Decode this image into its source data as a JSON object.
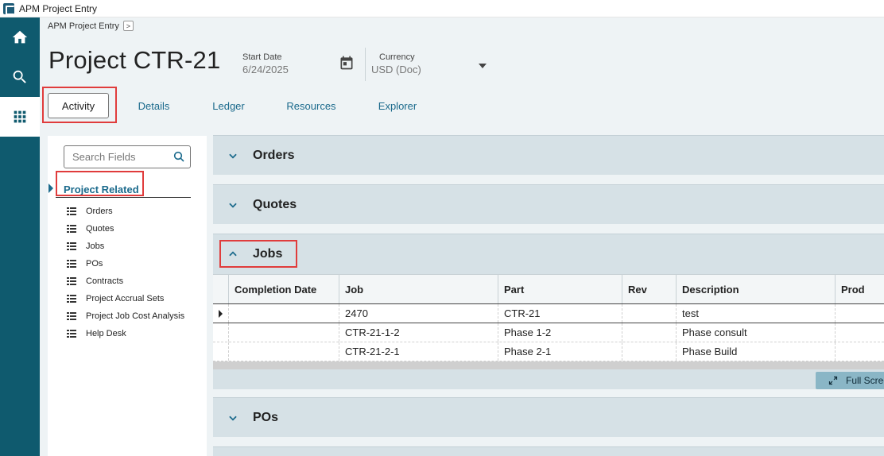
{
  "window": {
    "title": "APM Project Entry"
  },
  "nav": {
    "icons": [
      "home-icon",
      "search-icon",
      "apps-grid-icon"
    ],
    "active": "apps-grid-icon"
  },
  "breadcrumb": {
    "label": "APM Project Entry",
    "arrow": ">"
  },
  "header": {
    "title": "Project CTR-21",
    "start_date_label": "Start Date",
    "start_date_value": "6/24/2025",
    "currency_label": "Currency",
    "currency_value": "USD (Doc)"
  },
  "tabs": [
    {
      "label": "Activity",
      "active": true
    },
    {
      "label": "Details",
      "active": false
    },
    {
      "label": "Ledger",
      "active": false
    },
    {
      "label": "Resources",
      "active": false
    },
    {
      "label": "Explorer",
      "active": false
    }
  ],
  "side_panel": {
    "search_placeholder": "Search Fields",
    "section_title": "Project Related",
    "items": [
      "Orders",
      "Quotes",
      "Jobs",
      "POs",
      "Contracts",
      "Project Accrual Sets",
      "Project Job Cost Analysis",
      "Help Desk"
    ]
  },
  "panels": {
    "orders": {
      "title": "Orders",
      "expanded": false
    },
    "quotes": {
      "title": "Quotes",
      "expanded": false
    },
    "jobs": {
      "title": "Jobs",
      "expanded": true
    },
    "pos": {
      "title": "POs",
      "expanded": false
    }
  },
  "jobs_grid": {
    "columns": [
      "Completion Date",
      "Job",
      "Part",
      "Rev",
      "Description",
      "Prod"
    ],
    "rows": [
      {
        "completion_date": "",
        "job": "2470",
        "part": "CTR-21",
        "rev": "",
        "description": "test",
        "prod": ""
      },
      {
        "completion_date": "",
        "job": "CTR-21-1-2",
        "part": "Phase 1-2",
        "rev": "",
        "description": "Phase consult",
        "prod": ""
      },
      {
        "completion_date": "",
        "job": "CTR-21-2-1",
        "part": "Phase 2-1",
        "rev": "",
        "description": "Phase Build",
        "prod": ""
      }
    ],
    "full_screen_label": "Full Screen"
  },
  "colors": {
    "nav_bg": "#0f5a6e",
    "accent": "#1b6a8c",
    "highlight": "#e03c3c",
    "panel_bg": "#d6e1e6"
  }
}
